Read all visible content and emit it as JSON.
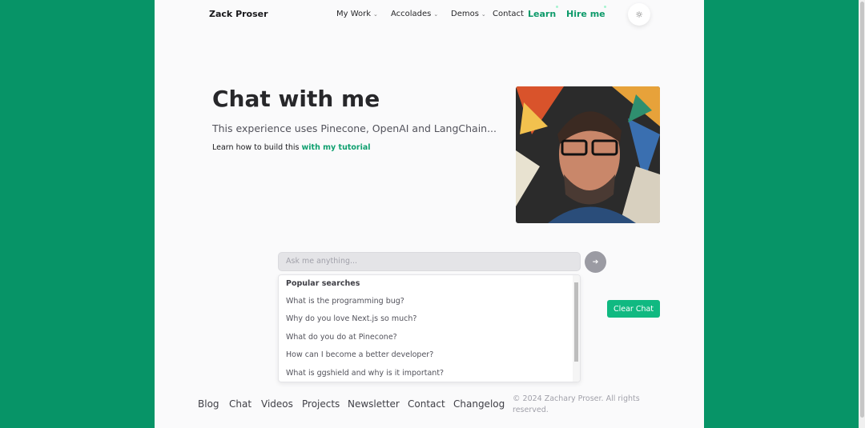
{
  "header": {
    "logo": "Zack Proser",
    "nav": [
      {
        "label": "My Work",
        "chevron": true
      },
      {
        "label": "Accolades",
        "chevron": true
      },
      {
        "label": "Demos",
        "chevron": true
      },
      {
        "label": "Contact"
      }
    ],
    "learn": "Learn",
    "hire": "Hire me",
    "theme_icon": "sun-icon"
  },
  "hero": {
    "title": "Chat with me",
    "subtitle": "This experience uses Pinecone, OpenAI and LangChain...",
    "learn_prefix": "Learn how to build this ",
    "learn_link": "with my tutorial"
  },
  "chat": {
    "placeholder": "Ask me anything...",
    "send_icon": "arrow-right-icon",
    "popular_heading": "Popular searches",
    "suggestions": [
      "What is the programming bug?",
      "Why do you love Next.js so much?",
      "What do you do at Pinecone?",
      "How can I become a better developer?",
      "What is ggshield and why is it important?"
    ],
    "clear": "Clear Chat"
  },
  "footer": {
    "links": [
      "Blog",
      "Chat",
      "Videos",
      "Projects",
      "Newsletter",
      "Contact",
      "Changelog"
    ],
    "copyright": "© 2024 Zachary Proser. All rights reserved."
  },
  "colors": {
    "background": "#079467",
    "accent": "#10b981"
  }
}
